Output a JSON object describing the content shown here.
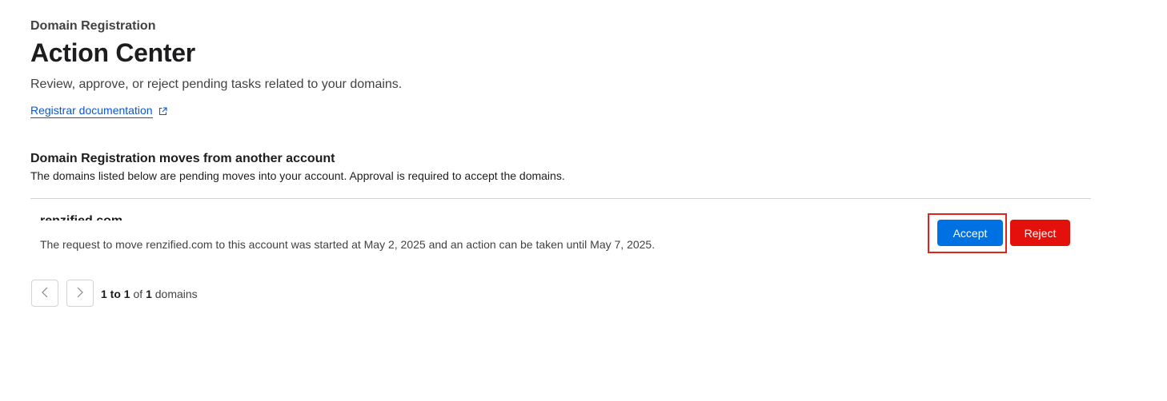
{
  "header": {
    "eyebrow": "Domain Registration",
    "title": "Action Center",
    "subtitle": "Review, approve, or reject pending tasks related to your domains.",
    "doc_link": "Registrar documentation",
    "doc_link_icon": "external-link-icon"
  },
  "section": {
    "title": "Domain Registration moves from another account",
    "description": "The domains listed below are pending moves into your account. Approval is required to accept the domains."
  },
  "rows": [
    {
      "domain": "renzified.com",
      "description": "The request to move renzified.com to this account was started at May 2, 2025 and an action can be taken until May 7, 2025.",
      "accept_label": "Accept",
      "reject_label": "Reject"
    }
  ],
  "pagination": {
    "prev_icon": "chevron-left-icon",
    "next_icon": "chevron-right-icon",
    "range_start": "1",
    "range_to": " to ",
    "range_end": "1",
    "of": " of ",
    "total": "1",
    "unit": " domains"
  },
  "colors": {
    "accept": "#0071e3",
    "reject": "#e3100b",
    "highlight": "#e3231a",
    "link": "#0a58ca"
  }
}
